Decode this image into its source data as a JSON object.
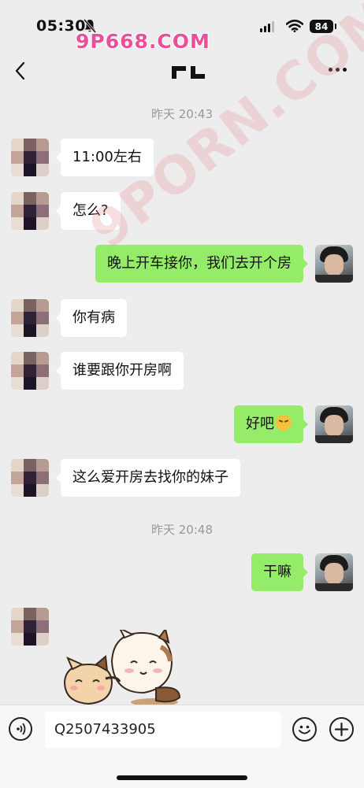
{
  "status": {
    "time": "05:30",
    "battery": "84"
  },
  "watermarks": {
    "top": "9P668.COM",
    "diagonal": "9PORN.COM"
  },
  "nav": {
    "back_icon": "chevron-left-icon",
    "more_icon": "more-dots-icon"
  },
  "messages": [
    {
      "type": "timestamp",
      "text": "昨天 20:43"
    },
    {
      "side": "in",
      "text": "11:00左右"
    },
    {
      "side": "in",
      "text": "怎么?"
    },
    {
      "side": "out",
      "text": "晚上开车接你，我们去开个房"
    },
    {
      "side": "in",
      "text": "你有病"
    },
    {
      "side": "in",
      "text": "谁要跟你开房啊"
    },
    {
      "side": "out",
      "text": "好吧",
      "emoji": "disappointed-face-icon"
    },
    {
      "side": "in",
      "text": "这么爱开房去找你的妹子"
    },
    {
      "type": "timestamp",
      "text": "昨天 20:48"
    },
    {
      "side": "out",
      "text": "干嘛"
    },
    {
      "side": "in",
      "sticker": "cartoon-cats-sticker"
    }
  ],
  "input": {
    "value": "Q2507433905"
  },
  "colors": {
    "background": "#ededed",
    "outgoing_bubble": "#95ec69",
    "incoming_bubble": "#ffffff"
  }
}
